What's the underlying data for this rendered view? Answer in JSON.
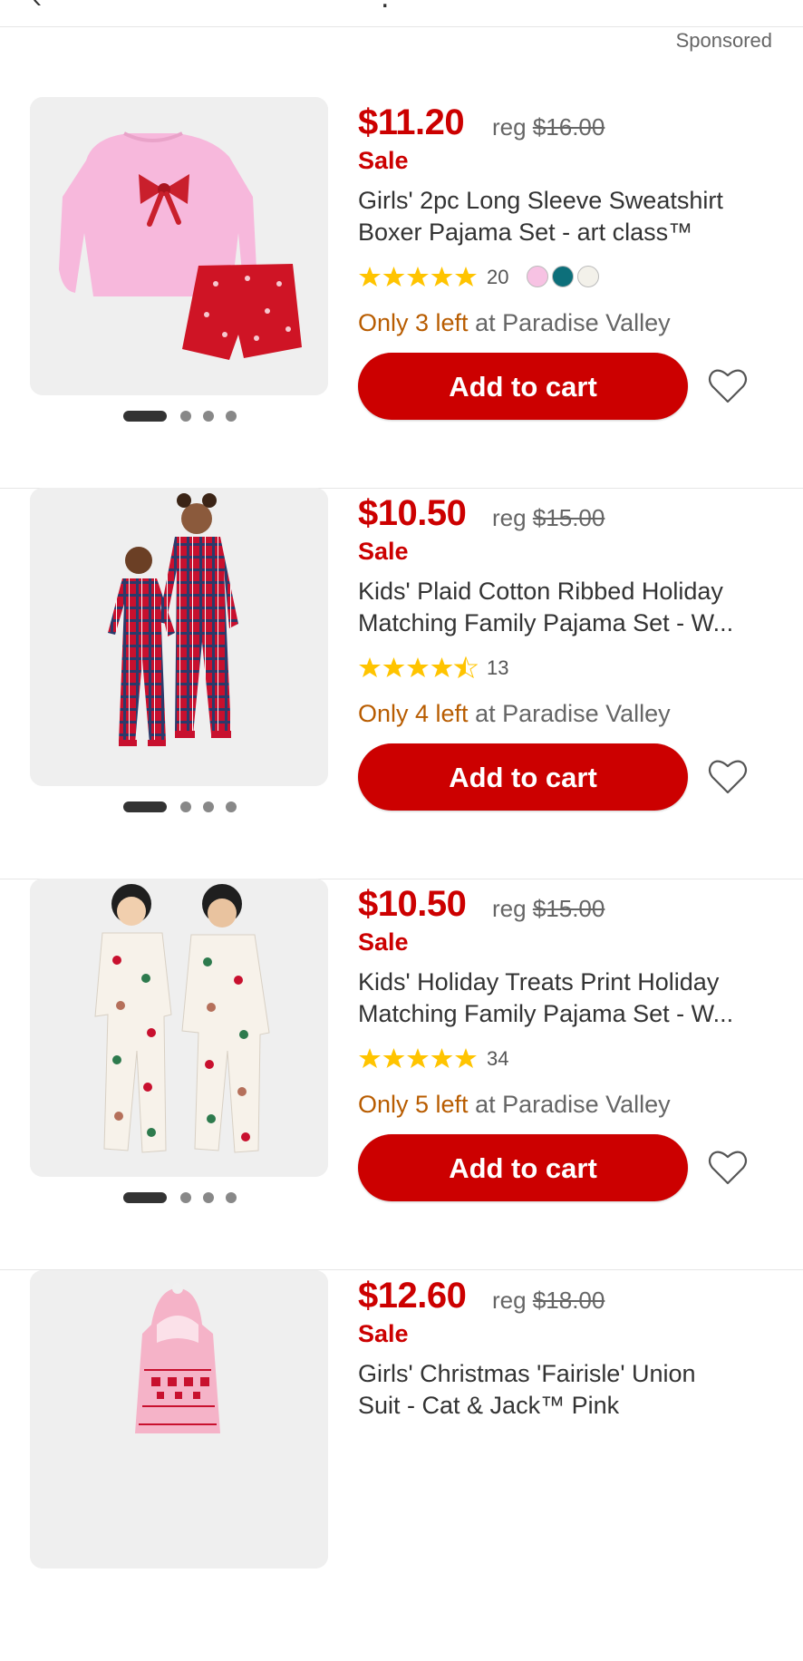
{
  "sponsored_label": "Sponsored",
  "colors": {
    "accent": "#cc0000",
    "low_stock": "#b85c00",
    "star": "#ffc400"
  },
  "products": [
    {
      "price": "$11.20",
      "reg_label": "reg",
      "reg_price": "$16.00",
      "sale_label": "Sale",
      "title": "Girls' 2pc Long Sleeve Sweatshirt\nBoxer Pajama Set - art class™",
      "rating": 5,
      "review_count": "20",
      "swatches": [
        "#f7c2e3",
        "#0d6f7a",
        "#f3f1ea"
      ],
      "stock_highlight": "Only 3 left",
      "stock_location": " at Paradise Valley",
      "cart_label": "Add to cart",
      "image_icon": "pajama-set-photo"
    },
    {
      "price": "$10.50",
      "reg_label": "reg",
      "reg_price": "$15.00",
      "sale_label": "Sale",
      "title": "Kids' Plaid Cotton Ribbed Holiday\nMatching Family Pajama Set - W...",
      "rating": 4.5,
      "review_count": "13",
      "swatches": [],
      "stock_highlight": "Only 4 left",
      "stock_location": " at Paradise Valley",
      "cart_label": "Add to cart",
      "image_icon": "plaid-pajama-photo"
    },
    {
      "price": "$10.50",
      "reg_label": "reg",
      "reg_price": "$15.00",
      "sale_label": "Sale",
      "title": "Kids' Holiday Treats Print Holiday\nMatching Family Pajama Set - W...",
      "rating": 5,
      "review_count": "34",
      "swatches": [],
      "stock_highlight": "Only 5 left",
      "stock_location": " at Paradise Valley",
      "cart_label": "Add to cart",
      "image_icon": "holiday-print-pajama-photo"
    },
    {
      "price": "$12.60",
      "reg_label": "reg",
      "reg_price": "$18.00",
      "sale_label": "Sale",
      "title": "Girls' Christmas 'Fairisle' Union\nSuit - Cat & Jack™ Pink",
      "image_icon": "union-suit-photo"
    }
  ]
}
